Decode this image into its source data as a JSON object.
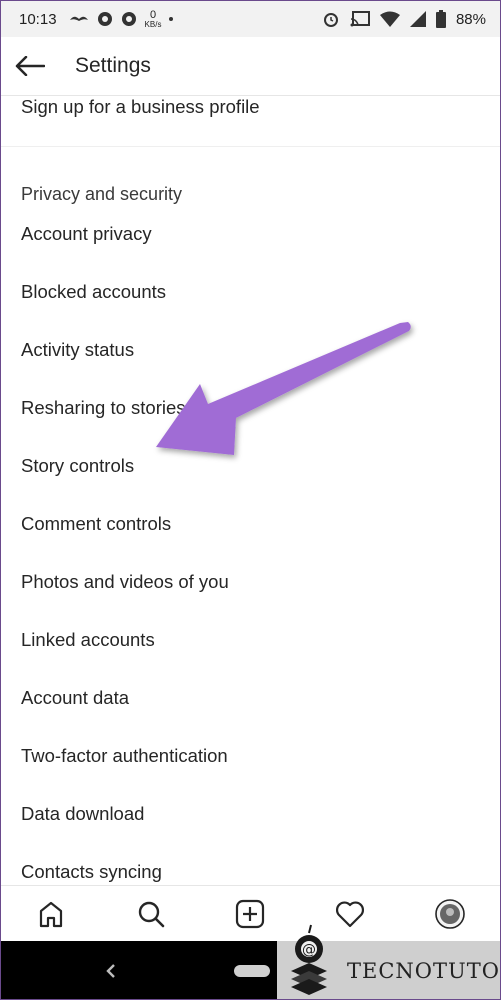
{
  "status_bar": {
    "time": "10:13",
    "network_speed_value": "0",
    "network_speed_unit": "KB/s",
    "battery": "88%"
  },
  "app_bar": {
    "title": "Settings"
  },
  "settings": {
    "top_item": "Sign up for a business profile",
    "section_title": "Privacy and security",
    "items": [
      "Account privacy",
      "Blocked accounts",
      "Activity status",
      "Resharing to stories",
      "Story controls",
      "Comment controls",
      "Photos and videos of you",
      "Linked accounts",
      "Account data",
      "Two-factor authentication",
      "Data download",
      "Contacts syncing"
    ]
  },
  "annotation": {
    "arrow_color": "#a06cd5",
    "points_to": "Story controls"
  },
  "bottom_nav": {
    "icons": [
      "home-icon",
      "search-icon",
      "new-post-icon",
      "activity-heart-icon",
      "profile-avatar"
    ]
  },
  "watermark": {
    "text": "TECNOTUTO"
  }
}
